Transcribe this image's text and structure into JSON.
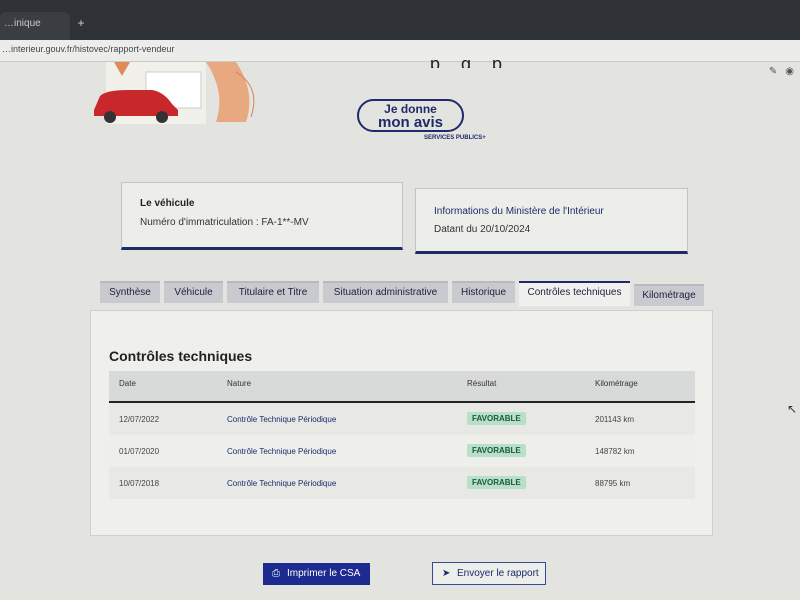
{
  "browser": {
    "tab_label": "…inique",
    "new_tab_icon": "+",
    "url": "…interieur.gouv.fr/histovec/rapport-vendeur"
  },
  "banner": {
    "illustration": "car-illustration",
    "avis_line1": "Je donne",
    "avis_line2": "mon avis",
    "services_publics": "SERVICES PUBLICS+"
  },
  "vehicle_card": {
    "title": "Le véhicule",
    "plate_line": "Numéro d'immatriculation : FA-1**-MV"
  },
  "ministry_card": {
    "title": "Informations du Ministère de l'Intérieur",
    "date_line": "Datant du 20/10/2024"
  },
  "tabs": [
    {
      "label": "Synthèse"
    },
    {
      "label": "Véhicule"
    },
    {
      "label": "Titulaire et Titre"
    },
    {
      "label": "Situation administrative"
    },
    {
      "label": "Historique"
    },
    {
      "label": "Contrôles techniques",
      "active": true
    },
    {
      "label": "Kilométrage"
    }
  ],
  "panel": {
    "title": "Contrôles techniques",
    "columns": [
      "Date",
      "Nature",
      "Résultat",
      "Kilométrage"
    ],
    "rows": [
      {
        "date": "12/07/2022",
        "nature": "Contrôle Technique Périodique",
        "result": "FAVORABLE",
        "km": "201143 km"
      },
      {
        "date": "01/07/2020",
        "nature": "Contrôle Technique Périodique",
        "result": "FAVORABLE",
        "km": "148782 km"
      },
      {
        "date": "10/07/2018",
        "nature": "Contrôle Technique Périodique",
        "result": "FAVORABLE",
        "km": "88795 km"
      }
    ]
  },
  "actions": {
    "print_label": "Imprimer le CSA",
    "send_label": "Envoyer le rapport"
  },
  "colors": {
    "accent": "#1d2a8f",
    "success_badge_bg": "#b8dfc9",
    "success_badge_text": "#1c5a3a"
  }
}
